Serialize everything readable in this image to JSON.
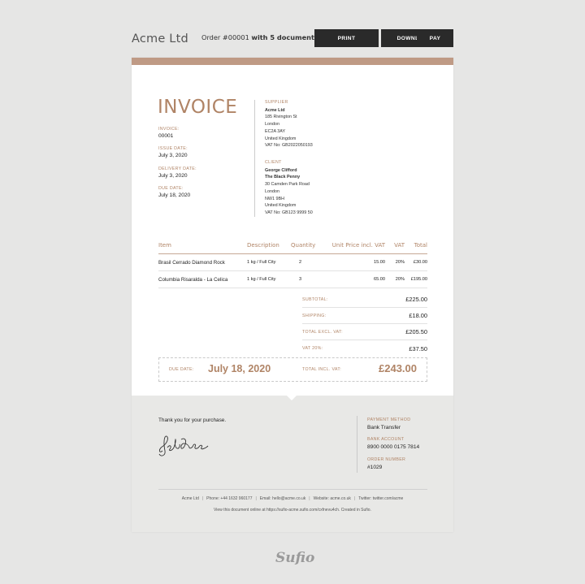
{
  "topbar": {
    "company": "Acme Ltd",
    "order_prefix": "Order #00001",
    "order_suffix": "with 5 documents",
    "print_label": "PRINT",
    "download_label": "DOWNLOAD",
    "pay_label": "PAY"
  },
  "colors": {
    "accent": "#b08466",
    "accent_bar": "#bf9a85",
    "button": "#2a2a2a",
    "background": "#e6e6e5"
  },
  "invoice": {
    "title": "INVOICE",
    "meta": [
      {
        "label": "INVOICE:",
        "value": "00001"
      },
      {
        "label": "ISSUE DATE:",
        "value": "July 3, 2020"
      },
      {
        "label": "DELIVERY DATE:",
        "value": "July 3, 2020"
      },
      {
        "label": "DUE DATE:",
        "value": "July 18, 2020"
      }
    ],
    "supplier": {
      "label": "SUPPLIER",
      "name": "Acme Ltd",
      "lines": [
        "185 Rivington St",
        "London",
        "EC2A 3AY",
        "United Kingdom",
        "VAT No: GB2022050193"
      ]
    },
    "client": {
      "label": "CLIENT",
      "name": "George Clifford",
      "company": "The Black Penny",
      "lines": [
        "30 Camden Park Road",
        "London",
        "NW1 9BH",
        "United Kingdom",
        "VAT No: GB123 9999 50"
      ]
    }
  },
  "items": {
    "headers": [
      "Item",
      "Description",
      "Quantity",
      "Unit Price incl. VAT",
      "VAT",
      "Total"
    ],
    "rows": [
      [
        "Brasil Cerrado Diamond Rock",
        "1 kg / Full City",
        "2",
        "15.00",
        "20%",
        "£30.00"
      ],
      [
        "Columbia Risaralda - La Celica",
        "1 kg / Full City",
        "3",
        "65.00",
        "20%",
        "£195.00"
      ]
    ]
  },
  "summary": [
    {
      "label": "SUBTOTAL:",
      "value": "£225.00"
    },
    {
      "label": "SHIPPING:",
      "value": "£18.00"
    },
    {
      "label": "TOTAL EXCL. VAT:",
      "value": "£205.50"
    },
    {
      "label": "VAT 20%:",
      "value": "£37.50"
    }
  ],
  "due": {
    "label": "DUE DATE:",
    "date": "July 18, 2020",
    "total_label": "TOTAL INCL. VAT:",
    "total": "£243.00"
  },
  "footer": {
    "thanks": "Thank you for your purchase.",
    "payment_method_label": "PAYMENT METHOD",
    "payment_method": "Bank Transfer",
    "bank_account_label": "BANK ACCOUNT",
    "bank_account": "8900 0000 0175 7814",
    "order_number_label": "ORDER NUMBER",
    "order_number": "#1029",
    "contacts": [
      "Acme Ltd",
      "Phone: +44 1632 960177",
      "Email: hello@acme.co.uk",
      "Website: acme.co.uk",
      "Twitter: twitter.com/acme"
    ],
    "view_online": "View this document online at https://sufio-acme.sufio.com/cxfnevu4ch. Created in Sufio."
  },
  "brand": {
    "logo_text": "Sufio"
  }
}
